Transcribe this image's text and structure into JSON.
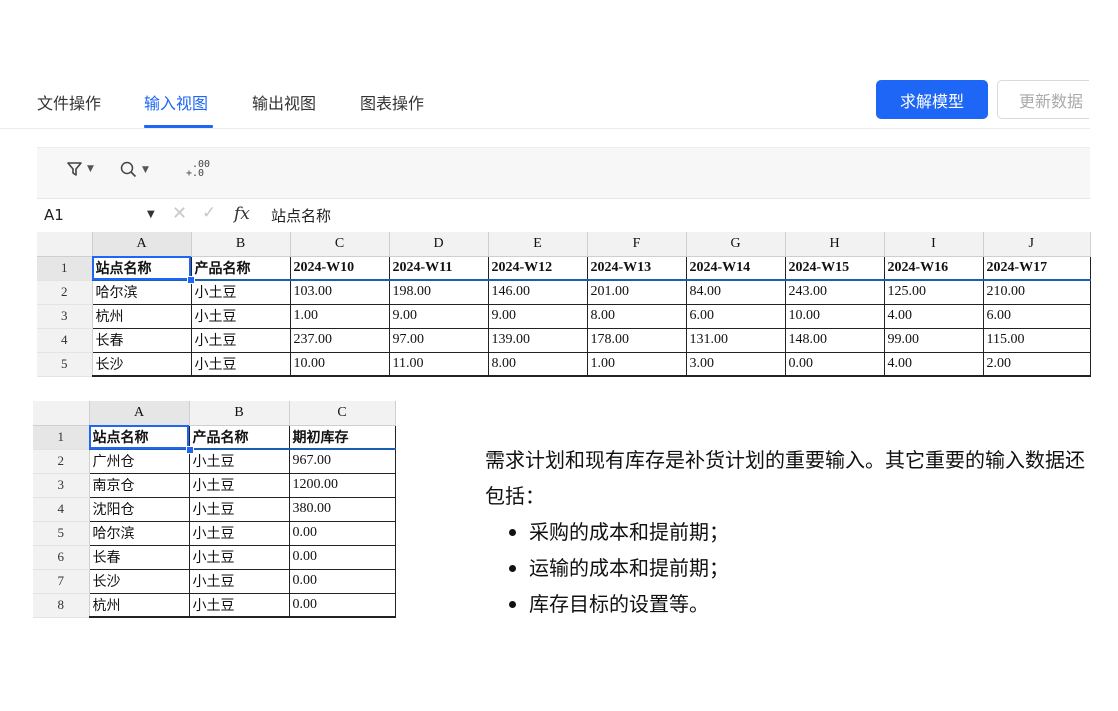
{
  "tabs": [
    {
      "label": "文件操作",
      "active": false
    },
    {
      "label": "输入视图",
      "active": true
    },
    {
      "label": "输出视图",
      "active": false
    },
    {
      "label": "图表操作",
      "active": false
    }
  ],
  "buttons": {
    "solve": "求解模型",
    "update": "更新数据"
  },
  "colors": {
    "accent": "#1e66f5"
  },
  "toolbar": {
    "icons": [
      "filter-icon",
      "search-icon",
      "decimal-format-icon"
    ]
  },
  "formula_bar": {
    "cell_ref": "A1",
    "fx_label": "fx",
    "value": "站点名称"
  },
  "demand_sheet": {
    "col_headers": [
      "A",
      "B",
      "C",
      "D",
      "E",
      "F",
      "G",
      "H",
      "I",
      "J"
    ],
    "row_headers": [
      "1",
      "2",
      "3",
      "4",
      "5"
    ],
    "header": [
      "站点名称",
      "产品名称",
      "2024-W10",
      "2024-W11",
      "2024-W12",
      "2024-W13",
      "2024-W14",
      "2024-W15",
      "2024-W16",
      "2024-W17"
    ],
    "rows": [
      [
        "哈尔滨",
        "小土豆",
        "103.00",
        "198.00",
        "146.00",
        "201.00",
        "84.00",
        "243.00",
        "125.00",
        "210.00"
      ],
      [
        "杭州",
        "小土豆",
        "1.00",
        "9.00",
        "9.00",
        "8.00",
        "6.00",
        "10.00",
        "4.00",
        "6.00"
      ],
      [
        "长春",
        "小土豆",
        "237.00",
        "97.00",
        "139.00",
        "178.00",
        "131.00",
        "148.00",
        "99.00",
        "115.00"
      ],
      [
        "长沙",
        "小土豆",
        "10.00",
        "11.00",
        "8.00",
        "1.00",
        "3.00",
        "0.00",
        "4.00",
        "2.00"
      ]
    ]
  },
  "inventory_sheet": {
    "col_headers": [
      "A",
      "B",
      "C"
    ],
    "row_headers": [
      "1",
      "2",
      "3",
      "4",
      "5",
      "6",
      "7",
      "8"
    ],
    "header": [
      "站点名称",
      "产品名称",
      "期初库存"
    ],
    "rows": [
      [
        "广州仓",
        "小土豆",
        "967.00"
      ],
      [
        "南京仓",
        "小土豆",
        "1200.00"
      ],
      [
        "沈阳仓",
        "小土豆",
        "380.00"
      ],
      [
        "哈尔滨",
        "小土豆",
        "0.00"
      ],
      [
        "长春",
        "小土豆",
        "0.00"
      ],
      [
        "长沙",
        "小土豆",
        "0.00"
      ],
      [
        "杭州",
        "小土豆",
        "0.00"
      ]
    ]
  },
  "description": {
    "intro": "需求计划和现有库存是补货计划的重要输入。其它重要的输入数据还包括：",
    "bullets": [
      "采购的成本和提前期；",
      "运输的成本和提前期；",
      "库存目标的设置等。"
    ]
  }
}
